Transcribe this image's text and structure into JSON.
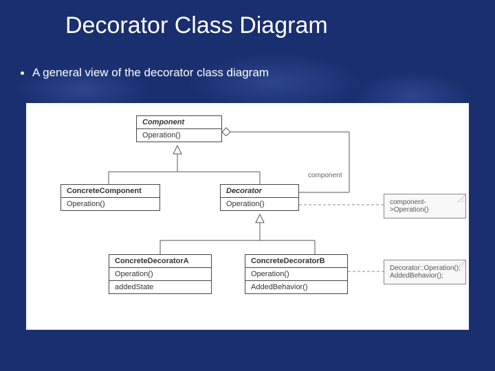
{
  "title": "Decorator Class Diagram",
  "bullet": "A general view of the decorator class diagram",
  "uml": {
    "component": {
      "name": "Component",
      "op": "Operation()"
    },
    "concreteComponent": {
      "name": "ConcreteComponent",
      "op": "Operation()"
    },
    "decorator": {
      "name": "Decorator",
      "op": "Operation()"
    },
    "concreteDecoratorA": {
      "name": "ConcreteDecoratorA",
      "op": "Operation()",
      "state": "addedState"
    },
    "concreteDecoratorB": {
      "name": "ConcreteDecoratorB",
      "op": "Operation()",
      "extra": "AddedBehavior()"
    },
    "roleLabel": "component",
    "note1": "component->Operation()",
    "note2a": "Decorator::Operation();",
    "note2b": "AddedBehavior();"
  }
}
